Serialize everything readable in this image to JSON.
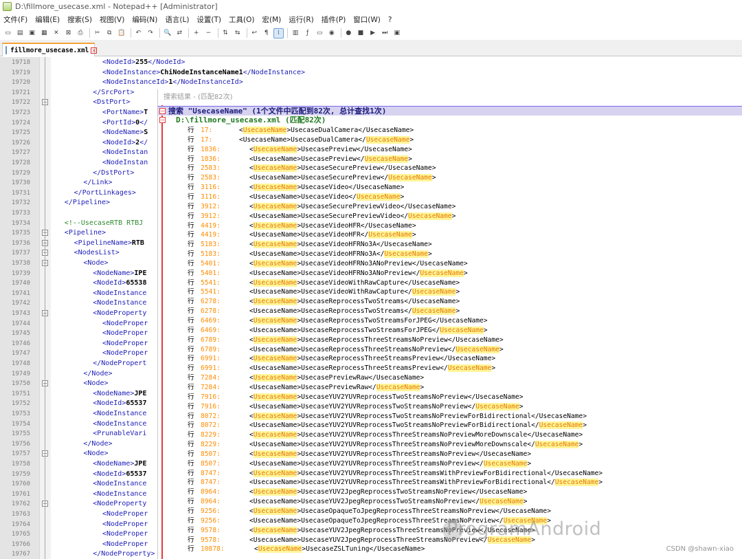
{
  "window": {
    "title": "D:\\fillmore_usecase.xml - Notepad++ [Administrator]"
  },
  "menu": [
    "文件(F)",
    "编辑(E)",
    "搜索(S)",
    "视图(V)",
    "编码(N)",
    "语言(L)",
    "设置(T)",
    "工具(O)",
    "宏(M)",
    "运行(R)",
    "插件(P)",
    "窗口(W)",
    "?"
  ],
  "toolbar": {
    "icons": [
      "new-file-icon",
      "open-file-icon",
      "save-icon",
      "save-all-icon",
      "close-icon",
      "close-all-icon",
      "print-icon",
      "sep",
      "cut-icon",
      "copy-icon",
      "paste-icon",
      "sep",
      "undo-icon",
      "redo-icon",
      "sep",
      "find-icon",
      "replace-icon",
      "sep",
      "zoom-in-icon",
      "zoom-out-icon",
      "sep",
      "sync-vertical-icon",
      "sync-horizontal-icon",
      "sep",
      "word-wrap-icon",
      "show-all-chars-icon",
      "indent-guide-icon",
      "sep",
      "doc-map-icon",
      "function-list-icon",
      "folder-workspace-icon",
      "monitor-icon",
      "sep",
      "record-macro-icon",
      "stop-record-icon",
      "play-macro-icon",
      "run-multiple-icon",
      "save-macro-icon"
    ],
    "glyphs": [
      "▭",
      "▤",
      "▣",
      "▦",
      "✕",
      "⊠",
      "⎙",
      "",
      "✂",
      "⧉",
      "📋",
      "",
      "↶",
      "↷",
      "",
      "🔍",
      "⇄",
      "",
      "+",
      "−",
      "",
      "⇅",
      "⇆",
      "",
      "↩",
      "¶",
      "⁞",
      "",
      "▥",
      "ƒ",
      "▭",
      "◉",
      "",
      "●",
      "■",
      "▶",
      "⏭",
      "▣"
    ]
  },
  "tab": {
    "label": "fillmore_usecase.xml"
  },
  "editor": {
    "lines": [
      {
        "n": "19718",
        "indent": 10,
        "html": "<NodeId>255</NodeId>"
      },
      {
        "n": "19719",
        "indent": 10,
        "html": "<NodeInstance>ChiNodeInstanceName1</NodeInstance>"
      },
      {
        "n": "19720",
        "indent": 10,
        "html": "<NodeInstanceId>1</NodeInstanceId>"
      },
      {
        "n": "19721",
        "indent": 8,
        "html": "</SrcPort>"
      },
      {
        "n": "19722",
        "indent": 8,
        "html": "<DstPort>"
      },
      {
        "n": "19723",
        "indent": 10,
        "html": "<PortName>T"
      },
      {
        "n": "19724",
        "indent": 10,
        "html": "<PortId>0</"
      },
      {
        "n": "19725",
        "indent": 10,
        "html": "<NodeName>S"
      },
      {
        "n": "19726",
        "indent": 10,
        "html": "<NodeId>2</"
      },
      {
        "n": "19727",
        "indent": 10,
        "html": "<NodeInstan"
      },
      {
        "n": "19728",
        "indent": 10,
        "html": "<NodeInstan"
      },
      {
        "n": "19729",
        "indent": 8,
        "html": "</DstPort>"
      },
      {
        "n": "19730",
        "indent": 6,
        "html": "</Link>"
      },
      {
        "n": "19731",
        "indent": 4,
        "html": "</PortLinkages>"
      },
      {
        "n": "19732",
        "indent": 2,
        "html": "</Pipeline>"
      },
      {
        "n": "19733",
        "indent": 0,
        "html": ""
      },
      {
        "n": "19734",
        "indent": 2,
        "html": "<!--UsecaseRTB RTBJ"
      },
      {
        "n": "19735",
        "indent": 2,
        "html": "<Pipeline>"
      },
      {
        "n": "19736",
        "indent": 4,
        "html": "<PipelineName>RTB"
      },
      {
        "n": "19737",
        "indent": 4,
        "html": "<NodesList>"
      },
      {
        "n": "19738",
        "indent": 6,
        "html": "<Node>"
      },
      {
        "n": "19739",
        "indent": 8,
        "html": "<NodeName>IPE"
      },
      {
        "n": "19740",
        "indent": 8,
        "html": "<NodeId>65538"
      },
      {
        "n": "19741",
        "indent": 8,
        "html": "<NodeInstance"
      },
      {
        "n": "19742",
        "indent": 8,
        "html": "<NodeInstance"
      },
      {
        "n": "19743",
        "indent": 8,
        "html": "<NodeProperty"
      },
      {
        "n": "19744",
        "indent": 10,
        "html": "<NodeProper"
      },
      {
        "n": "19745",
        "indent": 10,
        "html": "<NodeProper"
      },
      {
        "n": "19746",
        "indent": 10,
        "html": "<NodeProper"
      },
      {
        "n": "19747",
        "indent": 10,
        "html": "<NodeProper"
      },
      {
        "n": "19748",
        "indent": 8,
        "html": "</NodePropert"
      },
      {
        "n": "19749",
        "indent": 6,
        "html": "</Node>"
      },
      {
        "n": "19750",
        "indent": 6,
        "html": "<Node>"
      },
      {
        "n": "19751",
        "indent": 8,
        "html": "<NodeName>JPE"
      },
      {
        "n": "19752",
        "indent": 8,
        "html": "<NodeId>65537"
      },
      {
        "n": "19753",
        "indent": 8,
        "html": "<NodeInstance"
      },
      {
        "n": "19754",
        "indent": 8,
        "html": "<NodeInstance"
      },
      {
        "n": "19755",
        "indent": 8,
        "html": "<PrunableVari"
      },
      {
        "n": "19756",
        "indent": 6,
        "html": "</Node>"
      },
      {
        "n": "19757",
        "indent": 6,
        "html": "<Node>"
      },
      {
        "n": "19758",
        "indent": 8,
        "html": "<NodeName>JPE"
      },
      {
        "n": "19759",
        "indent": 8,
        "html": "<NodeId>65537"
      },
      {
        "n": "19760",
        "indent": 8,
        "html": "<NodeInstance"
      },
      {
        "n": "19761",
        "indent": 8,
        "html": "<NodeInstance"
      },
      {
        "n": "19762",
        "indent": 8,
        "html": "<NodeProperty"
      },
      {
        "n": "19763",
        "indent": 10,
        "html": "<NodeProper"
      },
      {
        "n": "19764",
        "indent": 10,
        "html": "<NodeProper"
      },
      {
        "n": "19765",
        "indent": 10,
        "html": "<NodeProper"
      },
      {
        "n": "19766",
        "indent": 10,
        "html": "<NodeProper"
      },
      {
        "n": "19767",
        "indent": 8,
        "html": "</NodeProperty>"
      }
    ]
  },
  "search": {
    "caption": "搜索结果 - (匹配82次)",
    "header": "搜索 \"UsecaseName\" (1个文件中匹配到82次, 总计查找1次)",
    "file": "D:\\fillmore_usecase.xml (匹配82次)",
    "line_prefix": "行",
    "results": [
      {
        "line": "17:",
        "pre": "<",
        "hl": "UsecaseName",
        "post": ">UsecaseDualCamera</UsecaseName>",
        "mode": "open"
      },
      {
        "line": "17:",
        "pre": "<UsecaseName>UsecaseDualCamera</",
        "hl": "UsecaseName",
        "post": ">",
        "mode": "close"
      },
      {
        "line": "1836:",
        "pre": "<",
        "hl": "UsecaseName",
        "post": ">UsecasePreview</UsecaseName>",
        "mode": "open"
      },
      {
        "line": "1836:",
        "pre": "<UsecaseName>UsecasePreview</",
        "hl": "UsecaseName",
        "post": ">",
        "mode": "close"
      },
      {
        "line": "2583:",
        "pre": "<",
        "hl": "UsecaseName",
        "post": ">UsecaseSecurePreview</UsecaseName>",
        "mode": "open"
      },
      {
        "line": "2583:",
        "pre": "<UsecaseName>UsecaseSecurePreview</",
        "hl": "UsecaseName",
        "post": ">",
        "mode": "close"
      },
      {
        "line": "3116:",
        "pre": "<",
        "hl": "UsecaseName",
        "post": ">UsecaseVideo</UsecaseName>",
        "mode": "open"
      },
      {
        "line": "3116:",
        "pre": "<UsecaseName>UsecaseVideo</",
        "hl": "UsecaseName",
        "post": ">",
        "mode": "close"
      },
      {
        "line": "3912:",
        "pre": "<",
        "hl": "UsecaseName",
        "post": ">UsecaseSecurePreviewVideo</UsecaseName>",
        "mode": "open"
      },
      {
        "line": "3912:",
        "pre": "<UsecaseName>UsecaseSecurePreviewVideo</",
        "hl": "UsecaseName",
        "post": ">",
        "mode": "close"
      },
      {
        "line": "4419:",
        "pre": "<",
        "hl": "UsecaseName",
        "post": ">UsecaseVideoHFR</UsecaseName>",
        "mode": "open"
      },
      {
        "line": "4419:",
        "pre": "<UsecaseName>UsecaseVideoHFR</",
        "hl": "UsecaseName",
        "post": ">",
        "mode": "close"
      },
      {
        "line": "5183:",
        "pre": "<",
        "hl": "UsecaseName",
        "post": ">UsecaseVideoHFRNo3A</UsecaseName>",
        "mode": "open"
      },
      {
        "line": "5183:",
        "pre": "<UsecaseName>UsecaseVideoHFRNo3A</",
        "hl": "UsecaseName",
        "post": ">",
        "mode": "close"
      },
      {
        "line": "5401:",
        "pre": "<",
        "hl": "UsecaseName",
        "post": ">UsecaseVideoHFRNo3ANoPreview</UsecaseName>",
        "mode": "open"
      },
      {
        "line": "5401:",
        "pre": "<UsecaseName>UsecaseVideoHFRNo3ANoPreview</",
        "hl": "UsecaseName",
        "post": ">",
        "mode": "close"
      },
      {
        "line": "5541:",
        "pre": "<",
        "hl": "UsecaseName",
        "post": ">UsecaseVideoWithRawCapture</UsecaseName>",
        "mode": "open"
      },
      {
        "line": "5541:",
        "pre": "<UsecaseName>UsecaseVideoWithRawCapture</",
        "hl": "UsecaseName",
        "post": ">",
        "mode": "close"
      },
      {
        "line": "6278:",
        "pre": "<",
        "hl": "UsecaseName",
        "post": ">UsecaseReprocessTwoStreams</UsecaseName>",
        "mode": "open"
      },
      {
        "line": "6278:",
        "pre": "<UsecaseName>UsecaseReprocessTwoStreams</",
        "hl": "UsecaseName",
        "post": ">",
        "mode": "close"
      },
      {
        "line": "6469:",
        "pre": "<",
        "hl": "UsecaseName",
        "post": ">UsecaseReprocessTwoStreamsForJPEG</UsecaseName>",
        "mode": "open"
      },
      {
        "line": "6469:",
        "pre": "<UsecaseName>UsecaseReprocessTwoStreamsForJPEG</",
        "hl": "UsecaseName",
        "post": ">",
        "mode": "close"
      },
      {
        "line": "6789:",
        "pre": "<",
        "hl": "UsecaseName",
        "post": ">UsecaseReprocessThreeStreamsNoPreview</UsecaseName>",
        "mode": "open"
      },
      {
        "line": "6789:",
        "pre": "<UsecaseName>UsecaseReprocessThreeStreamsNoPreview</",
        "hl": "UsecaseName",
        "post": ">",
        "mode": "close"
      },
      {
        "line": "6991:",
        "pre": "<",
        "hl": "UsecaseName",
        "post": ">UsecaseReprocessThreeStreamsPreview</UsecaseName>",
        "mode": "open"
      },
      {
        "line": "6991:",
        "pre": "<UsecaseName>UsecaseReprocessThreeStreamsPreview</",
        "hl": "UsecaseName",
        "post": ">",
        "mode": "close"
      },
      {
        "line": "7284:",
        "pre": "<",
        "hl": "UsecaseName",
        "post": ">UsecasePreviewRaw</UsecaseName>",
        "mode": "open"
      },
      {
        "line": "7284:",
        "pre": "<UsecaseName>UsecasePreviewRaw</",
        "hl": "UsecaseName",
        "post": ">",
        "mode": "close"
      },
      {
        "line": "7916:",
        "pre": "<",
        "hl": "UsecaseName",
        "post": ">UsecaseYUV2YUVReprocessTwoStreamsNoPreview</UsecaseName>",
        "mode": "open"
      },
      {
        "line": "7916:",
        "pre": "<UsecaseName>UsecaseYUV2YUVReprocessTwoStreamsNoPreview</",
        "hl": "UsecaseName",
        "post": ">",
        "mode": "close"
      },
      {
        "line": "8072:",
        "pre": "<",
        "hl": "UsecaseName",
        "post": ">UsecaseYUV2YUVReprocessTwoStreamsNoPreviewForBidirectional</UsecaseName>",
        "mode": "open"
      },
      {
        "line": "8072:",
        "pre": "<UsecaseName>UsecaseYUV2YUVReprocessTwoStreamsNoPreviewForBidirectional</",
        "hl": "UsecaseName",
        "post": ">",
        "mode": "close"
      },
      {
        "line": "8229:",
        "pre": "<",
        "hl": "UsecaseName",
        "post": ">UsecaseYUV2YUVReprocessThreeStreamsNoPreviewMoreDownscale</UsecaseName>",
        "mode": "open"
      },
      {
        "line": "8229:",
        "pre": "<UsecaseName>UsecaseYUV2YUVReprocessThreeStreamsNoPreviewMoreDownscale</",
        "hl": "UsecaseName",
        "post": ">",
        "mode": "close"
      },
      {
        "line": "8507:",
        "pre": "<",
        "hl": "UsecaseName",
        "post": ">UsecaseYUV2YUVReprocessThreeStreamsNoPreview</UsecaseName>",
        "mode": "open"
      },
      {
        "line": "8507:",
        "pre": "<UsecaseName>UsecaseYUV2YUVReprocessThreeStreamsNoPreview</",
        "hl": "UsecaseName",
        "post": ">",
        "mode": "close"
      },
      {
        "line": "8747:",
        "pre": "<",
        "hl": "UsecaseName",
        "post": ">UsecaseYUV2YUVReprocessThreeStreamsWithPreviewForBidirectional</UsecaseName>",
        "mode": "open"
      },
      {
        "line": "8747:",
        "pre": "<UsecaseName>UsecaseYUV2YUVReprocessThreeStreamsWithPreviewForBidirectional</",
        "hl": "UsecaseName",
        "post": ">",
        "mode": "close"
      },
      {
        "line": "8964:",
        "pre": "<",
        "hl": "UsecaseName",
        "post": ">UsecaseYUV2JpegReprocessTwoStreamsNoPreview</UsecaseName>",
        "mode": "open"
      },
      {
        "line": "8964:",
        "pre": "<UsecaseName>UsecaseYUV2JpegReprocessTwoStreamsNoPreview</",
        "hl": "UsecaseName",
        "post": ">",
        "mode": "close"
      },
      {
        "line": "9256:",
        "pre": "<",
        "hl": "UsecaseName",
        "post": ">UsecaseOpaqueToJpegReprocessThreeStreamsNoPreview</UsecaseName>",
        "mode": "open"
      },
      {
        "line": "9256:",
        "pre": "<UsecaseName>UsecaseOpaqueToJpegReprocessThreeStreamsNoPreview</",
        "hl": "UsecaseName",
        "post": ">",
        "mode": "close"
      },
      {
        "line": "9578:",
        "pre": "<",
        "hl": "UsecaseName",
        "post": ">UsecaseYUV2JpegReprocessThreeStreamsNoPreview</UsecaseName>",
        "mode": "open"
      },
      {
        "line": "9578:",
        "pre": "<UsecaseName>UsecaseYUV2JpegReprocessThreeStreamsNoPreview</",
        "hl": "UsecaseName",
        "post": ">",
        "mode": "close"
      },
      {
        "line": "10878:",
        "pre": "<",
        "hl": "UsecaseName",
        "post": ">UsecaseZSLTuning</UsecaseName>",
        "mode": "open"
      }
    ]
  },
  "watermark": {
    "text": "ProgramAndroid",
    "credit": "CSDN @shawn-xiao"
  }
}
